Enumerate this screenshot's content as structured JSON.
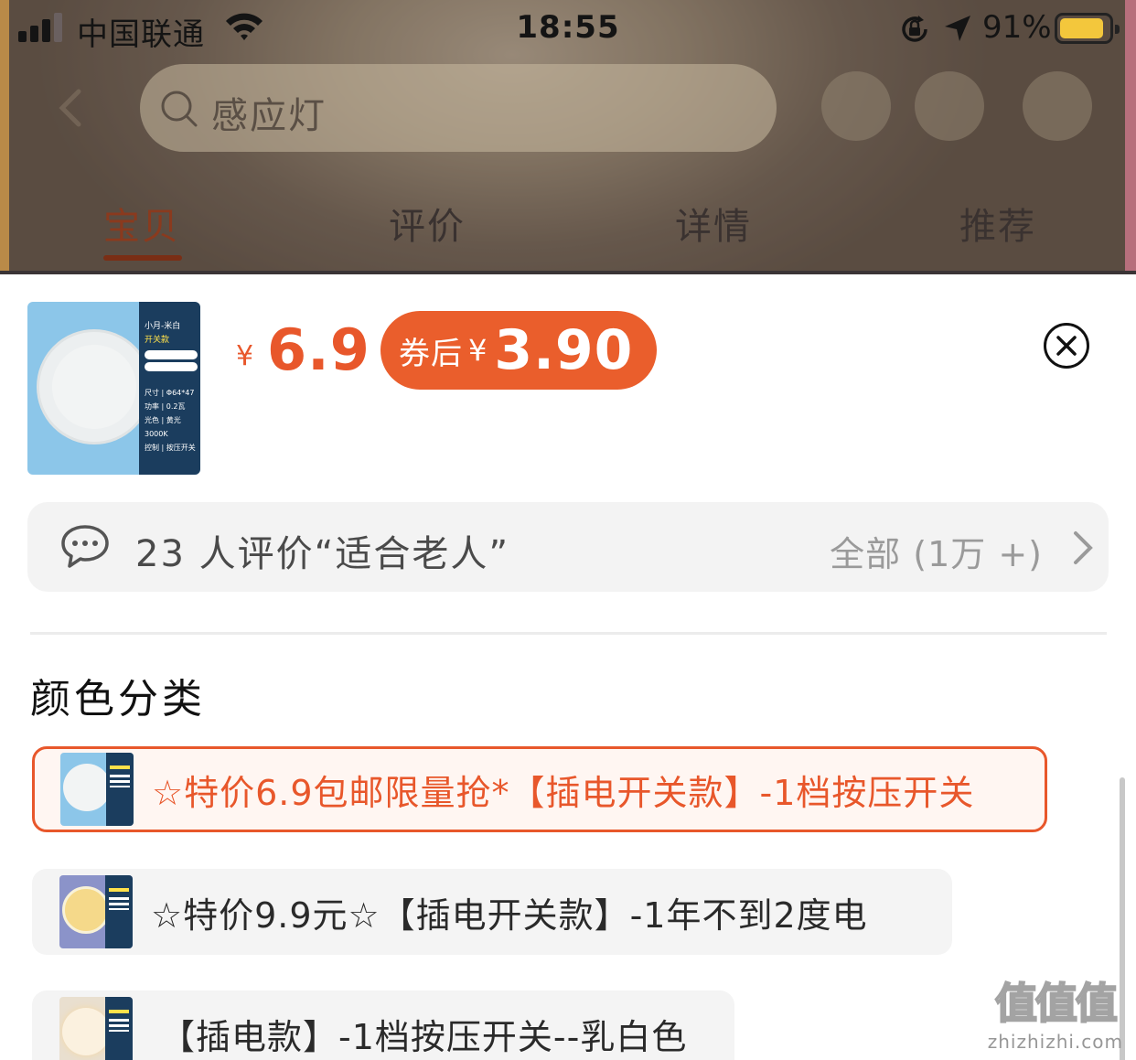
{
  "status_bar": {
    "carrier": "中国联通",
    "time": "18:55",
    "battery_percent": "91%",
    "battery_level": 0.91
  },
  "header": {
    "search_text": "感应灯",
    "tabs": [
      {
        "label": "宝贝",
        "active": true
      },
      {
        "label": "评价",
        "active": false
      },
      {
        "label": "详情",
        "active": false
      },
      {
        "label": "推荐",
        "active": false
      }
    ]
  },
  "sku_sheet": {
    "product_image": {
      "name_line1": "小月-米白",
      "name_line2": "开关款",
      "specs": [
        "尺寸 | Φ64*47",
        "功率 | 0.2瓦",
        "光色 | 黄光3000K",
        "控制 | 按压开关"
      ]
    },
    "price_symbol": "¥",
    "price": "6.9",
    "coupon": {
      "label": "券后",
      "symbol": "¥",
      "value": "3.90"
    },
    "review": {
      "summary": "23 人评价“适合老人”",
      "all_label": "全部 (1万 +)"
    },
    "section_title": "颜色分类",
    "options": [
      {
        "label": "☆特价6.9包邮限量抢*【插电开关款】-1档按压开关",
        "selected": true
      },
      {
        "label": "☆特价9.9元☆【插电开关款】-1年不到2度电",
        "selected": false
      },
      {
        "label": "【插电款】-1档按压开关--乳白色",
        "selected": false
      }
    ]
  },
  "watermark": {
    "logo": "值值值",
    "url": "zhizhizhi.com"
  },
  "colors": {
    "accent": "#e8572b",
    "coupon_bg": "#ea5e2c",
    "tab_active": "#8a3a1e"
  }
}
